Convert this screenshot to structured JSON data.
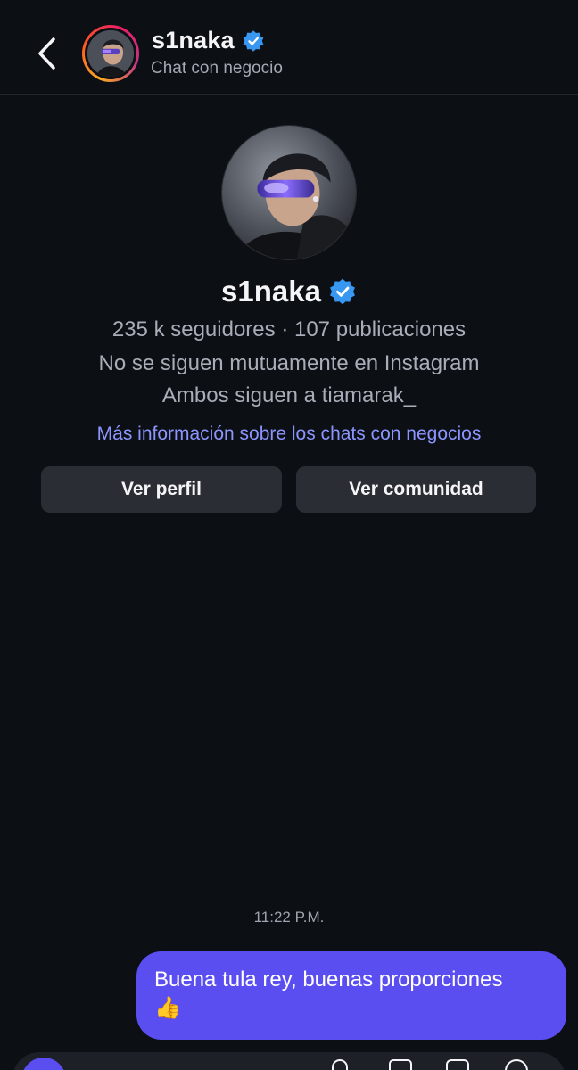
{
  "header": {
    "back_icon": "chevron-left-icon",
    "name": "s1naka",
    "subtitle": "Chat con negocio",
    "verified_icon": "verified-badge-icon"
  },
  "profile": {
    "name": "s1naka",
    "stats": "235 k seguidores · 107 publicaciones",
    "mutual": "No se siguen mutuamente en Instagram",
    "follows": "Ambos siguen a tiamarak_",
    "info_link": "Más información sobre los chats con negocios",
    "view_profile_label": "Ver perfil",
    "view_community_label": "Ver comunidad"
  },
  "chat": {
    "timestamp": "11:22 P.M.",
    "message_text": "Buena tula rey, buenas proporciones",
    "message_emoji": "👍"
  },
  "colors": {
    "background": "#0c0f14",
    "accent": "#5b4ef0",
    "link": "#8c95ff",
    "verified": "#3897f0"
  }
}
